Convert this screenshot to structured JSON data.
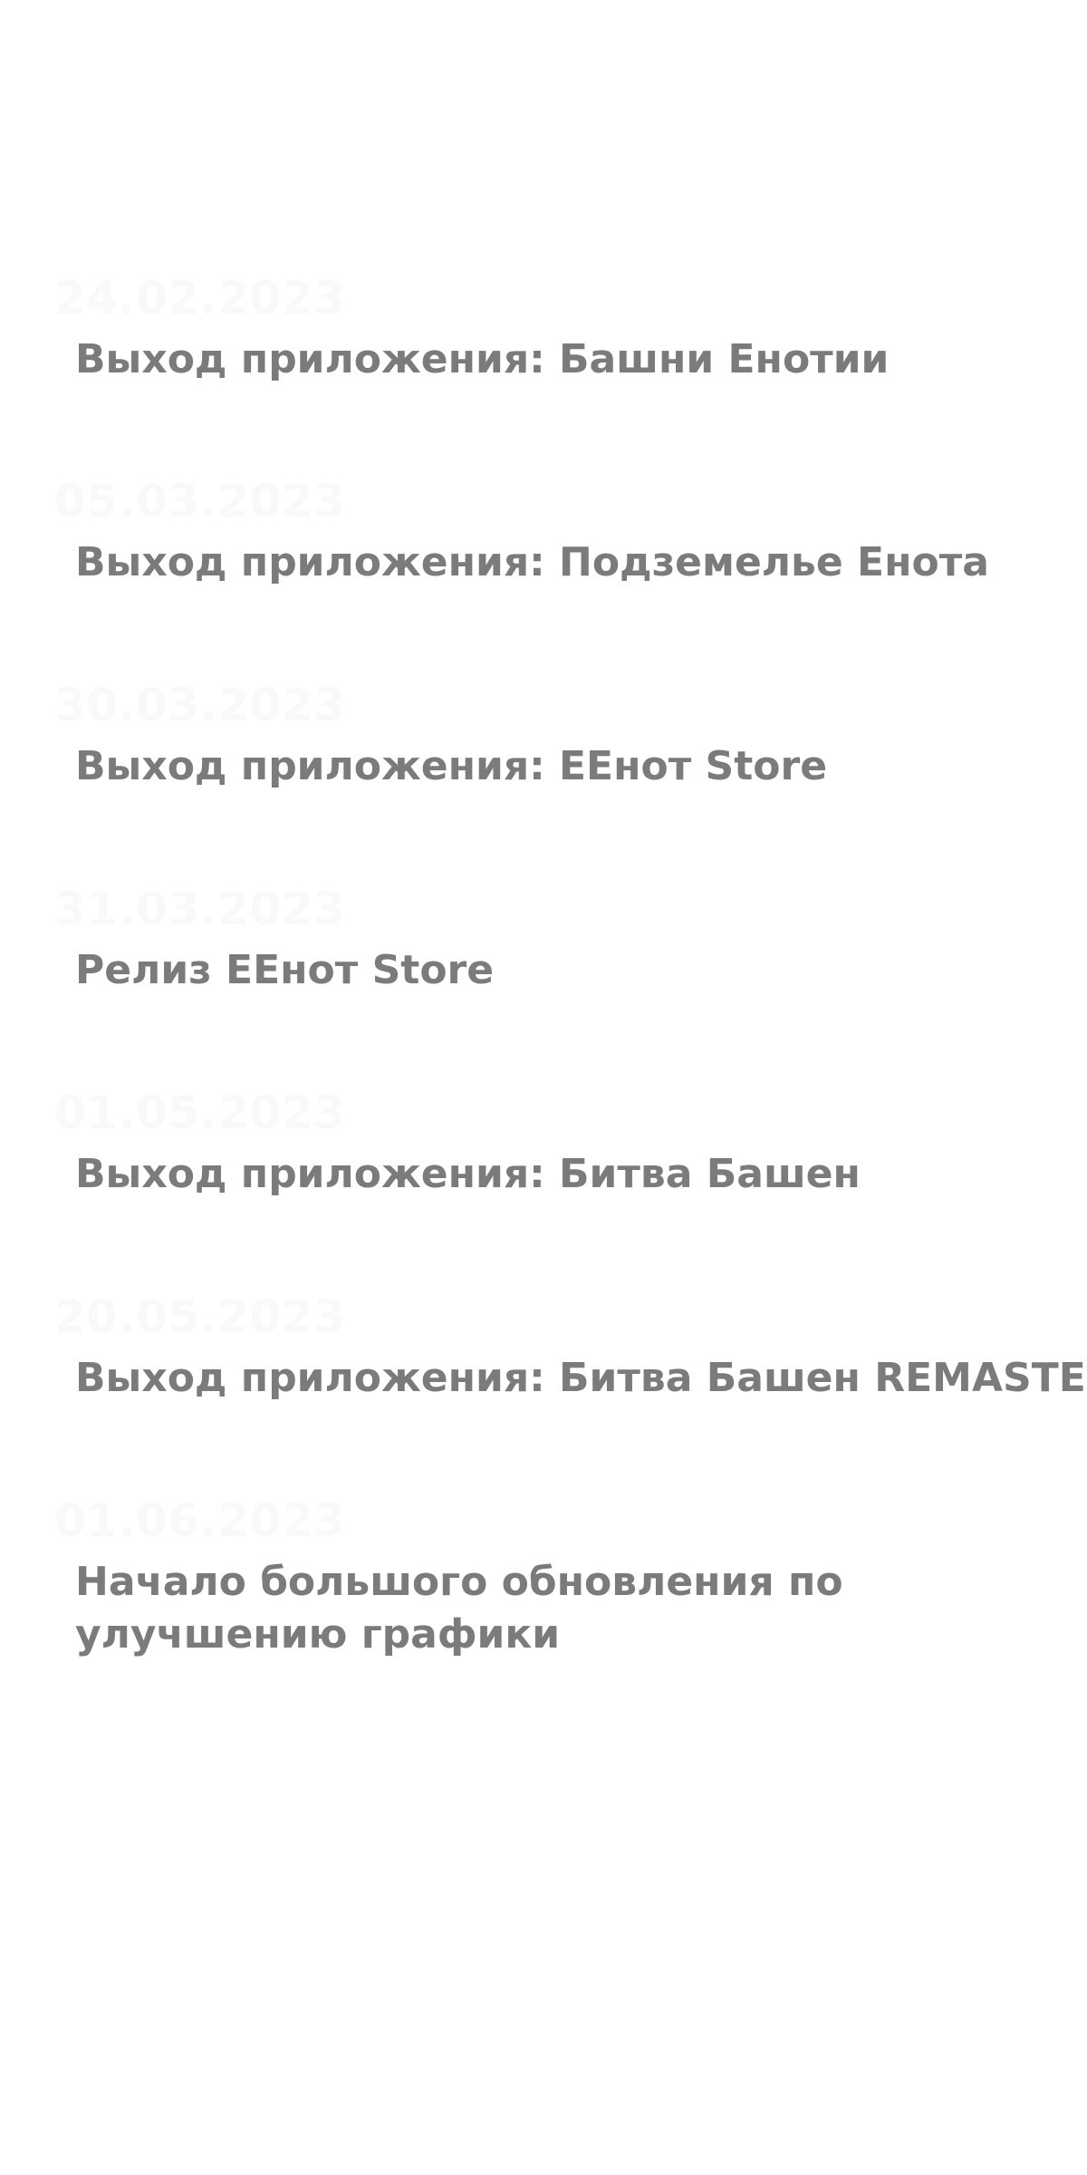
{
  "timeline": {
    "events": [
      {
        "date": "24.02.2023",
        "title": "Выход приложения: Башни Енотии"
      },
      {
        "date": "05.03.2023",
        "title": "Выход приложения: Подземелье Енота"
      },
      {
        "date": "30.03.2023",
        "title": "Выход приложения: ЕЕнот Store"
      },
      {
        "date": "31.03.2023",
        "title": "Релиз ЕЕнот Store"
      },
      {
        "date": "01.05.2023",
        "title": "Выход приложения: Битва Башен"
      },
      {
        "date": "20.05.2023",
        "title": "Выход приложения: Битва Башен REMASTER"
      },
      {
        "date": "01.06.2023",
        "title": "Начало большого обновления по улучшению графики"
      }
    ]
  },
  "colors": {
    "background": "#ffffff",
    "title_text": "#7b7b7b",
    "date_text": "#f9f9f9"
  }
}
